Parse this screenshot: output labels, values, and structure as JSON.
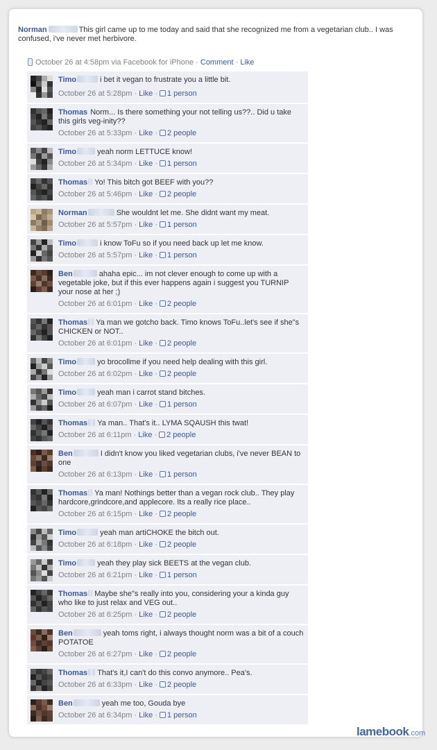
{
  "post": {
    "author": "Norman",
    "text": "This girl came up to me today and said that she recognized me from a vegetarian club.. I was confused, i've never met herbivore.",
    "timestamp": "October 26 at 4:58pm via Facebook for iPhone",
    "comment_link": "Comment",
    "like_link": "Like",
    "icon": "phone-icon"
  },
  "separator": "·",
  "like_label": "Like",
  "comments": [
    {
      "name": "Timo",
      "text": "i bet it vegan to frustrate you a little bit.",
      "time": "October 26 at 5:28pm",
      "likes": "1 person",
      "avatar": [
        "#222",
        "#444",
        "#aaa",
        "#ddd",
        "#111",
        "#666",
        "#ccc",
        "#333",
        "#888",
        "#222",
        "#ddd",
        "#555",
        "#eee",
        "#333",
        "#999",
        "#444"
      ]
    },
    {
      "name": "Thomas",
      "text": "Norm... Is there something your not telling us??.. Did u take this girls veg-inity??",
      "time": "October 26 at 5:33pm",
      "likes": "2 people",
      "avatar": [
        "#333",
        "#555",
        "#666",
        "#222",
        "#444",
        "#222",
        "#777",
        "#333",
        "#555",
        "#333",
        "#222",
        "#666",
        "#444",
        "#555",
        "#333",
        "#222"
      ]
    },
    {
      "name": "Timo",
      "text": "yeah norm LETTUCE know!",
      "time": "October 26 at 5:34pm",
      "likes": "1 person",
      "avatar": [
        "#555",
        "#888",
        "#444",
        "#bbb",
        "#777",
        "#333",
        "#999",
        "#555",
        "#ddd",
        "#444",
        "#222",
        "#888",
        "#999",
        "#666",
        "#333",
        "#aaa"
      ]
    },
    {
      "name": "Thomas",
      "text": "Yo! This bitch got BEEF with you??",
      "time": "October 26 at 5:46pm",
      "likes": "2 people",
      "avatar": [
        "#444",
        "#666",
        "#333",
        "#555",
        "#222",
        "#444",
        "#666",
        "#333",
        "#555",
        "#333",
        "#222",
        "#444",
        "#666",
        "#444",
        "#555",
        "#333"
      ]
    },
    {
      "name": "Norman",
      "text": "She wouldnt let me. She didnt want my meat.",
      "time": "October 26 at 5:57pm",
      "likes": "1 person",
      "avatar": [
        "#b8a58a",
        "#c9b598",
        "#8e7d66",
        "#a89478",
        "#d2c2a8",
        "#7a6a55",
        "#9c8a70",
        "#c1ae92",
        "#8a7a66",
        "#b09c80",
        "#6e5f4c",
        "#a08c72",
        "#c4b49c",
        "#948068",
        "#7e6e58",
        "#b8a68c"
      ]
    },
    {
      "name": "Timo",
      "text": "i know ToFu so if you need back up let me know.",
      "time": "October 26 at 5:57pm",
      "likes": "1 person",
      "avatar": [
        "#444",
        "#999",
        "#222",
        "#bbb",
        "#777",
        "#333",
        "#aaa",
        "#555",
        "#222",
        "#ccc",
        "#666",
        "#444",
        "#999",
        "#333",
        "#777",
        "#555"
      ]
    },
    {
      "name": "Ben",
      "text": "ahaha epic... im not clever enough to come up with a vegetable joke, but if this ever happens again i suggest you TURNIP your nose at her ;)",
      "time": "October 26 at 6:01pm",
      "likes": "2 people",
      "avatar": [
        "#3a2a22",
        "#6a4a3a",
        "#5a3a2e",
        "#2e201a",
        "#7a5a48",
        "#4a3228",
        "#8a6a58",
        "#3e2c24",
        "#5e4236",
        "#9a7a68",
        "#4e382e",
        "#6e4e40",
        "#2a1e18",
        "#5a4034",
        "#7e5e4c",
        "#3a2a22"
      ]
    },
    {
      "name": "Thomas",
      "text": "Ya man we gotcho back. Timo knows ToFu..let's see if she\"s CHICKEN or NOT..",
      "time": "October 26 at 6:01pm",
      "likes": "2 people",
      "avatar": [
        "#555",
        "#333",
        "#777",
        "#222",
        "#444",
        "#666",
        "#333",
        "#555",
        "#666",
        "#444",
        "#222",
        "#555",
        "#333",
        "#777",
        "#444",
        "#222"
      ]
    },
    {
      "name": "Timo",
      "text": "yo brocollme if you need help dealing with this girl.",
      "time": "October 26 at 6:02pm",
      "likes": "2 people",
      "avatar": [
        "#666",
        "#bbb",
        "#444",
        "#888",
        "#222",
        "#999",
        "#ccc",
        "#555",
        "#aaa",
        "#333",
        "#777",
        "#ddd",
        "#444",
        "#888",
        "#222",
        "#999"
      ]
    },
    {
      "name": "Timo",
      "text": "yeah man i carrot stand bitches.",
      "time": "October 26 at 6:07pm",
      "likes": "1 person",
      "avatar": [
        "#777",
        "#555",
        "#999",
        "#333",
        "#aaa",
        "#666",
        "#444",
        "#bbb",
        "#333",
        "#888",
        "#ccc",
        "#555",
        "#999",
        "#444",
        "#666",
        "#222"
      ]
    },
    {
      "name": "Thomas",
      "text": "Ya man.. That's it.. LYMA SQAUSH this twat!",
      "time": "October 26 at 6:11pm",
      "likes": "2 people",
      "avatar": [
        "#444",
        "#222",
        "#555",
        "#333",
        "#666",
        "#444",
        "#222",
        "#555",
        "#333",
        "#555",
        "#777",
        "#222",
        "#444",
        "#333",
        "#555",
        "#666"
      ]
    },
    {
      "name": "Ben",
      "text": "I didn't know you liked vegetarian clubs, i've never BEAN to one",
      "time": "October 26 at 6:13pm",
      "likes": "1 person",
      "avatar": [
        "#4a3228",
        "#2e201a",
        "#7a5a48",
        "#5a3a2e",
        "#6a4a3a",
        "#8a6a58",
        "#3a2a22",
        "#9a7a68",
        "#5e4236",
        "#3e2c24",
        "#6e4e40",
        "#4e382e",
        "#7e5e4c",
        "#2a1e18",
        "#5a4034",
        "#3a2a22"
      ]
    },
    {
      "name": "Thomas",
      "text": "Ya man! Nothings better than a vegan rock club.. They play hardcore,grindcore,and applecore. Its a really rice place..",
      "time": "October 26 at 6:15pm",
      "likes": "2 people",
      "avatar": [
        "#333",
        "#555",
        "#222",
        "#666",
        "#444",
        "#333",
        "#777",
        "#222",
        "#555",
        "#444",
        "#666",
        "#333",
        "#222",
        "#555",
        "#444",
        "#666"
      ]
    },
    {
      "name": "Timo",
      "text": "yeah man artiCHOKE the bitch out.",
      "time": "October 26 at 6:18pm",
      "likes": "2 people",
      "avatar": [
        "#888",
        "#444",
        "#bbb",
        "#666",
        "#333",
        "#999",
        "#555",
        "#ccc",
        "#444",
        "#aaa",
        "#777",
        "#333",
        "#bbb",
        "#555",
        "#888",
        "#444"
      ]
    },
    {
      "name": "Timo",
      "text": "yeah they play sick BEETS at the vegan club.",
      "time": "October 26 at 6:21pm",
      "likes": "1 person",
      "avatar": [
        "#999",
        "#666",
        "#ccc",
        "#444",
        "#777",
        "#bbb",
        "#333",
        "#aaa",
        "#555",
        "#888",
        "#ddd",
        "#444",
        "#777",
        "#999",
        "#555",
        "#ccc"
      ]
    },
    {
      "name": "Thomas",
      "text": "Maybe she\"s really into you, considering your a kinda guy who like to just relax and VEG out..",
      "time": "October 26 at 6:25pm",
      "likes": "2 people",
      "avatar": [
        "#222",
        "#444",
        "#666",
        "#333",
        "#555",
        "#222",
        "#444",
        "#666",
        "#333",
        "#555",
        "#222",
        "#444",
        "#666",
        "#333",
        "#555",
        "#444"
      ]
    },
    {
      "name": "Ben",
      "text": "yeah toms right, i always thought norm was a bit of a couch POTATOE",
      "time": "October 26 at 6:27pm",
      "likes": "2 people",
      "avatar": [
        "#6a4a3a",
        "#3a2a22",
        "#8a6a58",
        "#4a3228",
        "#5a3a2e",
        "#7a5a48",
        "#2e201a",
        "#9a7a68",
        "#6e4e40",
        "#3e2c24",
        "#5e4236",
        "#4e382e",
        "#7e5e4c",
        "#5a4034",
        "#2a1e18",
        "#6a4a3a"
      ]
    },
    {
      "name": "Thomas",
      "text": "That's it,I can't do this convo anymore.. Pea's.",
      "time": "October 26 at 6:33pm",
      "likes": "2 people",
      "avatar": [
        "#555",
        "#333",
        "#444",
        "#666",
        "#222",
        "#555",
        "#333",
        "#444",
        "#666",
        "#222",
        "#444",
        "#555",
        "#333",
        "#666",
        "#222",
        "#444"
      ]
    },
    {
      "name": "Ben",
      "text": "yeah me too, Gouda bye",
      "time": "October 26 at 6:34pm",
      "likes": "1 person",
      "avatar": [
        "#2e201a",
        "#5a3a2e",
        "#7a5a48",
        "#3a2a22",
        "#8a6a58",
        "#4a3228",
        "#6a4a3a",
        "#9a7a68",
        "#3e2c24",
        "#6e4e40",
        "#4e382e",
        "#5e4236",
        "#2a1e18",
        "#7e5e4c",
        "#3a2a22",
        "#5a4034"
      ]
    }
  ],
  "footer": {
    "logo": "lamebook",
    "logo_suffix": ".com"
  },
  "colors": {
    "link": "#3b5998",
    "comment_bg": "#edeff4",
    "meta_text": "#808080"
  }
}
